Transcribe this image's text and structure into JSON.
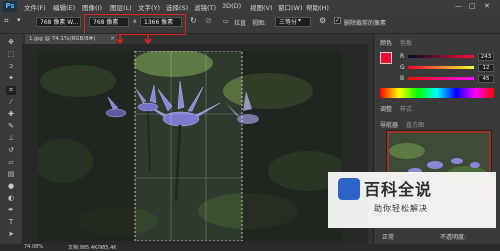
{
  "menubar": {
    "logo": "Ps",
    "items": [
      "文件(F)",
      "编辑(E)",
      "图像(I)",
      "图层(L)",
      "文字(Y)",
      "选择(S)",
      "滤镜(T)",
      "3D(D)",
      "视图(V)",
      "窗口(W)",
      "帮助(H)"
    ],
    "window_controls": [
      "—",
      "□",
      "✕"
    ]
  },
  "options": {
    "ratio_value": "768 像素 W...",
    "width_value": "768 像素",
    "swap_symbol": "x",
    "height_value": "1366 像素",
    "straighten_label": "拉直",
    "view_label": "视图:",
    "view_value": "三等分",
    "delete_crop_label": "删除裁剪的像素"
  },
  "document": {
    "tab_label": "1.jpg @ 74.1%(RGB/8#)"
  },
  "panel": {
    "tab_color": "颜色",
    "tab_swatches": "色板",
    "r_label": "R",
    "g_label": "G",
    "b_label": "B",
    "r_value": "243",
    "g_value": "12",
    "b_value": "45",
    "foreground_color": "#f30c2d",
    "tab_adjust": "调整",
    "tab_style": "样式",
    "tab_navigator": "导航器",
    "tab_histogram": "直方图",
    "layers_mode": "正常",
    "opacity_label": "不透明度:"
  },
  "status": {
    "zoom": "74.08%",
    "doc_info": "文档:985.4K/985.4K"
  },
  "watermark": {
    "title": "百科全说",
    "subtitle": "助你轻松解决"
  }
}
